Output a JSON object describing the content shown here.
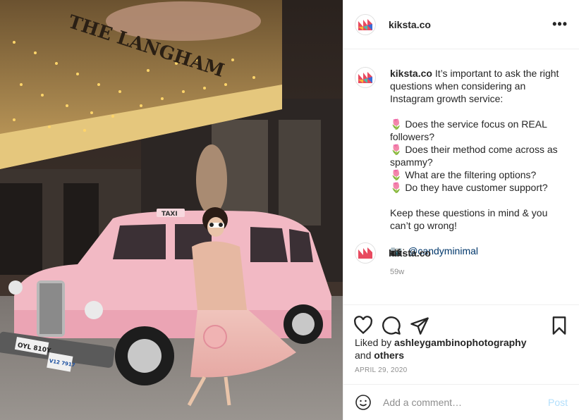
{
  "post": {
    "account": "kiksta.co",
    "more_icon": "ellipsis-icon",
    "caption": {
      "intro": "It’s important to ask the right questions when considering an Instagram growth service:",
      "questions": [
        "🌷 Does the service focus on REAL followers?",
        "🌷 Does their method come across as spammy?",
        "🌷 What are the filtering options?",
        "🌷 Do they have customer support?"
      ],
      "closing": "Keep these questions in mind & you can’t go wrong!",
      "credit_prefix": "📷: ",
      "credit_handle": "@candyminimal",
      "age": "59w"
    },
    "reply_preview_account": "kiksta.co",
    "actions": [
      "heart-icon",
      "comment-icon",
      "share-icon",
      "bookmark-icon"
    ],
    "likes": {
      "prefix": "Liked by ",
      "user": "ashleygambinophotography",
      "conjunction": " and",
      "others": "others"
    },
    "date": "APRIL 29, 2020",
    "comment_placeholder": "Add a comment…",
    "post_button": "Post"
  },
  "photo": {
    "hotel_sign": "THE LANGHAM",
    "taxi_sign": "TAXI",
    "plate_front": "OYL 810Y",
    "plate_side": "V12 7917"
  },
  "colors": {
    "link": "#00376b",
    "post_disabled": "#b2dffc",
    "taxi_pink": "#f2b9c4"
  }
}
